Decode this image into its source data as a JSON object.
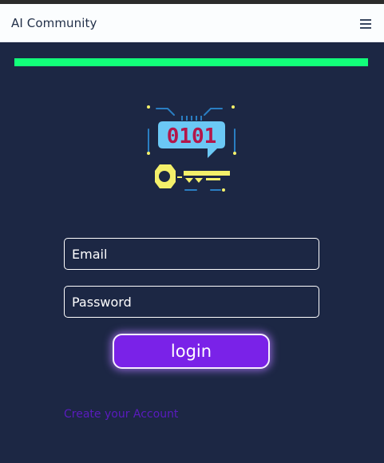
{
  "navbar": {
    "brand": "AI Community",
    "menu_icon": "hamburger-icon"
  },
  "progress": {
    "value_percent": 100,
    "color": "#12ff7a"
  },
  "logo": {
    "icon": "binary-key-chip-icon",
    "text": "0101"
  },
  "form": {
    "email_placeholder": "Email",
    "password_placeholder": "Password",
    "login_label": "login",
    "create_account_label": "Create your Account"
  },
  "colors": {
    "background": "#1c2744",
    "accent": "#7a22e8",
    "navbar_bg": "#fbfdfe",
    "link": "#5a1bbf"
  }
}
